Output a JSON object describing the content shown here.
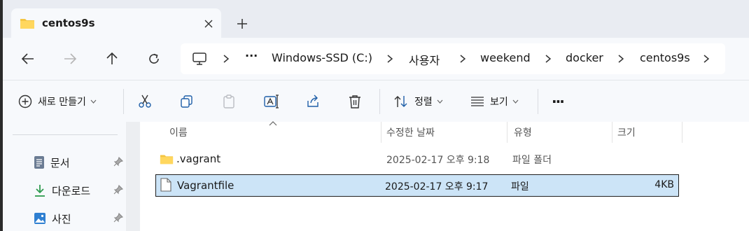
{
  "tab": {
    "title": "centos9s",
    "icon": "folder-icon"
  },
  "nav": {
    "back": "back-arrow-icon",
    "forward": "forward-arrow-icon",
    "up": "up-arrow-icon",
    "refresh": "refresh-icon"
  },
  "address": {
    "overflow": "···",
    "segments": [
      "Windows-SSD (C:)",
      "사용자",
      "weekend",
      "docker",
      "centos9s"
    ]
  },
  "toolbar": {
    "new_label": "새로 만들기",
    "sort_label": "정렬",
    "view_label": "보기",
    "more": "···"
  },
  "sidebar": {
    "items": [
      {
        "label": "문서",
        "icon": "documents-icon"
      },
      {
        "label": "다운로드",
        "icon": "downloads-icon"
      },
      {
        "label": "사진",
        "icon": "pictures-icon"
      }
    ]
  },
  "columns": {
    "name": "이름",
    "modified": "수정한 날짜",
    "type": "유형",
    "size": "크기"
  },
  "files": [
    {
      "name": ".vagrant",
      "modified": "2025-02-17 오후 9:18",
      "type": "파일 폴더",
      "size": "",
      "selected": false
    },
    {
      "name": "Vagrantfile",
      "modified": "2025-02-17 오후 9:17",
      "type": "파일",
      "size": "4KB",
      "selected": true
    }
  ],
  "colors": {
    "accent": "#0f6cbd",
    "selection": "#cce4f7",
    "folder": "#f4c542"
  }
}
